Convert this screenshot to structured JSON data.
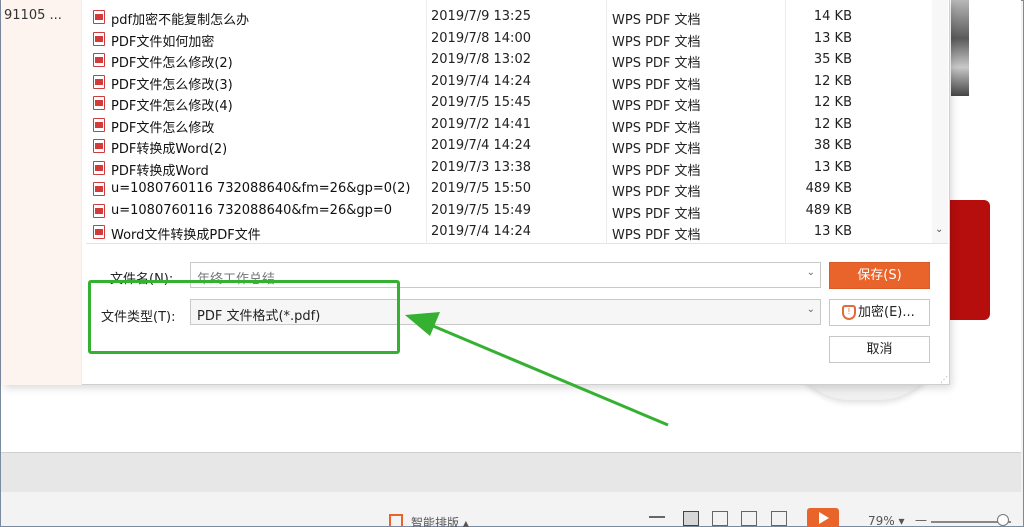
{
  "left_pane": {
    "item": "91105 ..."
  },
  "files": [
    {
      "name": "pdf加密不能复制怎么办",
      "date": "2019/7/9 13:25",
      "type": "WPS PDF 文档",
      "size": "14 KB"
    },
    {
      "name": "PDF文件如何加密",
      "date": "2019/7/8 14:00",
      "type": "WPS PDF 文档",
      "size": "13 KB"
    },
    {
      "name": "PDF文件怎么修改(2)",
      "date": "2019/7/8 13:02",
      "type": "WPS PDF 文档",
      "size": "35 KB"
    },
    {
      "name": "PDF文件怎么修改(3)",
      "date": "2019/7/4 14:24",
      "type": "WPS PDF 文档",
      "size": "12 KB"
    },
    {
      "name": "PDF文件怎么修改(4)",
      "date": "2019/7/5 15:45",
      "type": "WPS PDF 文档",
      "size": "12 KB"
    },
    {
      "name": "PDF文件怎么修改",
      "date": "2019/7/2 14:41",
      "type": "WPS PDF 文档",
      "size": "12 KB"
    },
    {
      "name": "PDF转换成Word(2)",
      "date": "2019/7/4 14:24",
      "type": "WPS PDF 文档",
      "size": "38 KB"
    },
    {
      "name": "PDF转换成Word",
      "date": "2019/7/3 13:38",
      "type": "WPS PDF 文档",
      "size": "13 KB"
    },
    {
      "name": "u=1080760116 732088640&fm=26&gp=0(2)",
      "date": "2019/7/5 15:50",
      "type": "WPS PDF 文档",
      "size": "489 KB"
    },
    {
      "name": "u=1080760116 732088640&fm=26&gp=0",
      "date": "2019/7/5 15:49",
      "type": "WPS PDF 文档",
      "size": "489 KB"
    },
    {
      "name": "Word文件转换成PDF文件",
      "date": "2019/7/4 14:24",
      "type": "WPS PDF 文档",
      "size": "13 KB"
    }
  ],
  "filename": {
    "label": "文件名(N):",
    "value": "年终工作总结"
  },
  "filetype": {
    "label": "文件类型(T):",
    "value": "PDF 文件格式(*.pdf)"
  },
  "buttons": {
    "save": "保存(S)",
    "encrypt": "加密(E)...",
    "cancel": "取消"
  },
  "status": {
    "smart_layout": "智能排版 ▴",
    "zoom": "79% ▾"
  },
  "colors": {
    "accent": "#e8642b",
    "highlight": "#35b031"
  }
}
